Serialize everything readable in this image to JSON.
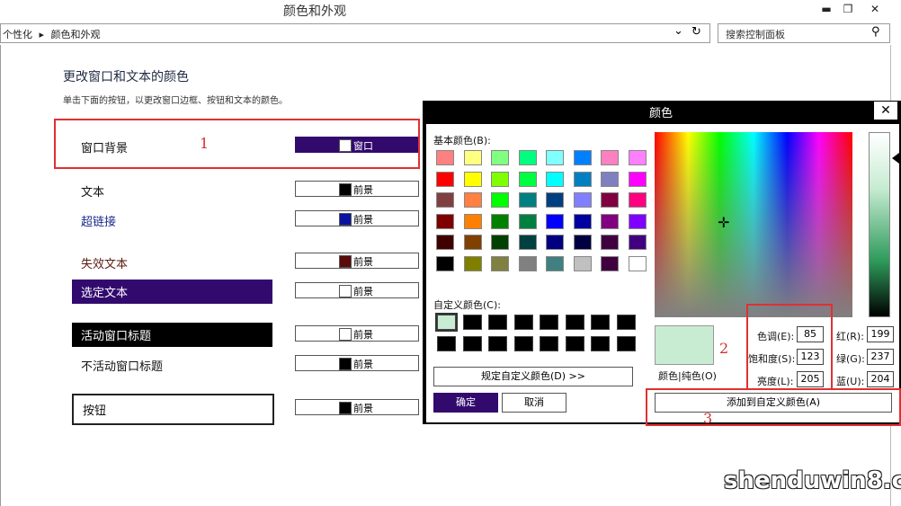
{
  "window": {
    "title": "颜色和外观",
    "minimize": "▬",
    "restore": "❐",
    "close": "✕"
  },
  "address": {
    "crumb1": "个性化",
    "sep": "▸",
    "crumb2": "颜色和外观",
    "dropdown_icon": "⌄",
    "refresh_icon": "↻"
  },
  "search": {
    "placeholder": "搜索控制面板",
    "icon": "⚲"
  },
  "main": {
    "heading": "更改窗口和文本的颜色",
    "subtext": "单击下面的按钮，以更改窗口边框、按钮和文本的颜色。",
    "items": [
      {
        "label": "窗口背景",
        "button": "窗口",
        "chip": "#ffffff"
      },
      {
        "label": "文本",
        "button": "前景",
        "chip": "#000000"
      },
      {
        "label": "超链接",
        "button": "前景",
        "chip": "#0a14a0"
      },
      {
        "label": "失效文本",
        "button": "前景",
        "chip": "#5b0a0a"
      },
      {
        "label": "选定文本",
        "button": "前景",
        "chip": "#ffffff"
      },
      {
        "label": "活动窗口标题",
        "button": "前景",
        "chip": "#ffffff"
      },
      {
        "label": "不活动窗口标题",
        "button": "前景",
        "chip": "#000000"
      },
      {
        "label": "按钮",
        "button": "前景",
        "chip": "#000000"
      }
    ]
  },
  "annotations": {
    "n1": "1",
    "n2": "2",
    "n3": "3"
  },
  "dialog": {
    "title": "颜色",
    "close": "✕",
    "basic_label": "基本颜色(B):",
    "basic_colors": [
      "#ff8080",
      "#ffff80",
      "#80ff80",
      "#00ff80",
      "#80ffff",
      "#0080ff",
      "#ff80c0",
      "#ff80ff",
      "#ff0000",
      "#ffff00",
      "#80ff00",
      "#00ff40",
      "#00ffff",
      "#0080c0",
      "#8080c0",
      "#ff00ff",
      "#804040",
      "#ff8040",
      "#00ff00",
      "#008080",
      "#004080",
      "#8080ff",
      "#800040",
      "#ff0080",
      "#800000",
      "#ff8000",
      "#008000",
      "#008040",
      "#0000ff",
      "#0000a0",
      "#800080",
      "#8000ff",
      "#400000",
      "#804000",
      "#004000",
      "#004040",
      "#000080",
      "#000040",
      "#400040",
      "#400080",
      "#000000",
      "#808000",
      "#808040",
      "#808080",
      "#408080",
      "#c0c0c0",
      "#400040",
      "#ffffff"
    ],
    "custom_label": "自定义颜色(C):",
    "define_custom": "规定自定义颜色(D) >>",
    "ok": "确定",
    "cancel": "取消",
    "preview_label": "颜色|纯色(O)",
    "hue_label": "色调(E):",
    "hue": "85",
    "sat_label": "饱和度(S):",
    "sat": "123",
    "lum_label": "亮度(L):",
    "lum": "205",
    "red_label": "红(R):",
    "red": "199",
    "green_label": "绿(G):",
    "green": "237",
    "blue_label": "蓝(U):",
    "blue": "204",
    "add_custom": "添加到自定义颜色(A)",
    "preview_color": "#c7ecd2"
  },
  "watermark": "shenduwin8.com"
}
